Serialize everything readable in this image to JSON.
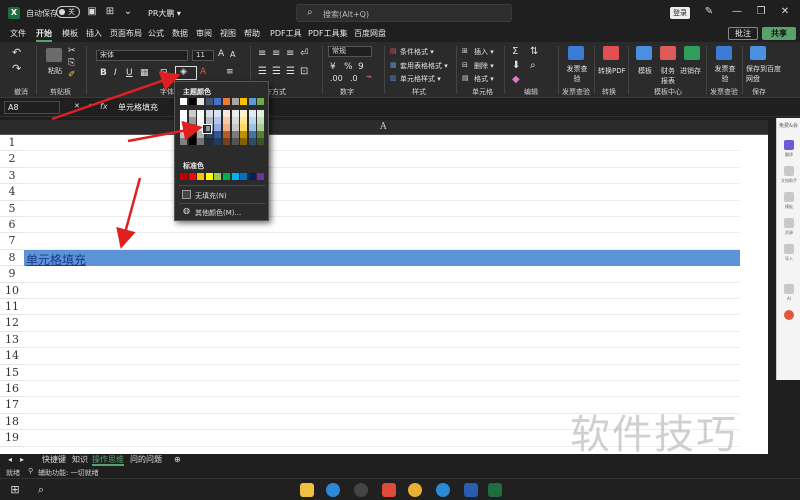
{
  "titlebar": {
    "autosave_label": "自动保存",
    "toggle_state": "关",
    "doc_title": "PR大鹏 ▾",
    "search_placeholder": "搜索(Alt+Q)",
    "login_label": "登录"
  },
  "menu": {
    "items": [
      "文件",
      "开始",
      "模板",
      "插入",
      "页面布局",
      "公式",
      "数据",
      "审阅",
      "视图",
      "帮助",
      "PDF工具",
      "PDF工具集",
      "百度网盘"
    ],
    "active": "开始",
    "comment_label": "批注",
    "share_label": "共享"
  },
  "ribbon": {
    "groups": [
      "撤消",
      "剪贴板",
      "字体",
      "对齐方式",
      "数字",
      "样式",
      "单元格",
      "编辑",
      "发票查验",
      "转换",
      "模板中心",
      "发票查验",
      "保存"
    ],
    "font_name": "宋体",
    "font_size": "11",
    "paste_label": "粘贴",
    "number_format": "常规",
    "styles": [
      "条件格式 ▾",
      "套用表格格式 ▾",
      "单元格样式 ▾"
    ],
    "cells": [
      "插入 ▾",
      "删除 ▾",
      "格式 ▾"
    ],
    "big_buttons": [
      "发票查验",
      "转换PDF",
      "模板",
      "财务报表",
      "进销存",
      "发票查验",
      "保存到百度网盘"
    ]
  },
  "formula": {
    "namebox": "A8",
    "fx": "fx",
    "content": "单元格填充"
  },
  "sheet": {
    "column_header": "A",
    "rows": [
      "1",
      "2",
      "3",
      "4",
      "5",
      "6",
      "7",
      "8",
      "9",
      "10",
      "11",
      "12",
      "13",
      "14",
      "15",
      "16",
      "17",
      "18",
      "19"
    ],
    "selected_row": "8",
    "cell_text": "单元格填充"
  },
  "color_popup": {
    "theme_title": "主题颜色",
    "standard_title": "标准色",
    "no_fill": "无填充(N)",
    "more_colors": "其他颜色(M)...",
    "theme_top": [
      "#ffffff",
      "#000000",
      "#e7e6e6",
      "#44546a",
      "#4472c4",
      "#ed7d31",
      "#a5a5a5",
      "#ffc000",
      "#5b9bd5",
      "#70ad47"
    ],
    "standard": [
      "#c00000",
      "#ff0000",
      "#ffc000",
      "#ffff00",
      "#92d050",
      "#00b050",
      "#00b0f0",
      "#0070c0",
      "#002060",
      "#7030a0"
    ]
  },
  "side_panel": {
    "label": "免费&会",
    "items": [
      "翻译",
      "文档助手",
      "模板",
      "资源",
      "导入",
      "AI"
    ]
  },
  "tabs": {
    "items": [
      "快捷键",
      "知识",
      "操作思维",
      "问的问题"
    ],
    "active": "操作思维"
  },
  "status": {
    "ready": "就绪",
    "accessibility": "辅助功能: 一切就绪"
  },
  "watermark": "软件技巧"
}
